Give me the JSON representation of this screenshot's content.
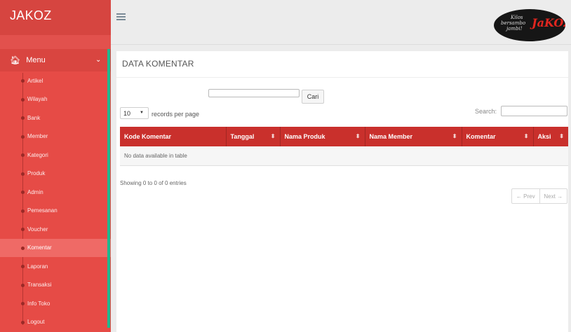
{
  "brand": "JAKOZ",
  "logo": {
    "text_lines": [
      "Kilos",
      "bersambo",
      "jambi!"
    ],
    "mark": "JaKOZ"
  },
  "sidebar": {
    "menu_label": "Menu",
    "items": [
      {
        "label": "Artikel",
        "active": false
      },
      {
        "label": "Wilayah",
        "active": false
      },
      {
        "label": "Bank",
        "active": false
      },
      {
        "label": "Member",
        "active": false
      },
      {
        "label": "Kategori",
        "active": false
      },
      {
        "label": "Produk",
        "active": false
      },
      {
        "label": "Admin",
        "active": false
      },
      {
        "label": "Pemesanan",
        "active": false
      },
      {
        "label": "Voucher",
        "active": false
      },
      {
        "label": "Komentar",
        "active": true
      },
      {
        "label": "Laporan",
        "active": false
      },
      {
        "label": "Transaksi",
        "active": false
      },
      {
        "label": "Info Toko",
        "active": false
      },
      {
        "label": "Logout",
        "active": false
      }
    ]
  },
  "page": {
    "title": "DATA KOMENTAR",
    "search_button": "Cari",
    "length_value": "10",
    "length_label": "records per page",
    "search_label": "Search:",
    "columns": [
      "Kode Komentar",
      "Tanggal",
      "Nama Produk",
      "Nama Member",
      "Komentar",
      "Aksi"
    ],
    "empty_message": "No data available in table",
    "info": "Showing 0 to 0 of 0 entries",
    "prev_label": "← Prev",
    "next_label": "Next →"
  },
  "colors": {
    "sidebar": "#e64b46",
    "header_row": "#c9302c",
    "accent": "#1fb88f"
  }
}
